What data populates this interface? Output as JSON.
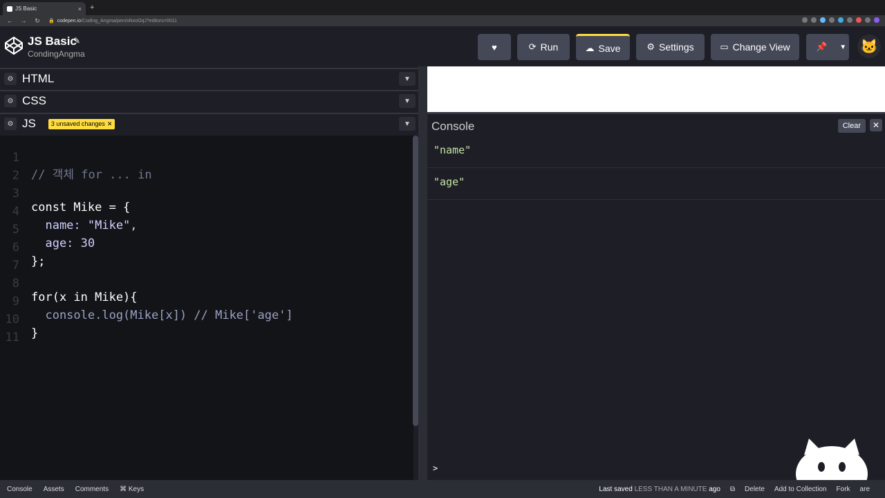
{
  "browser": {
    "tab_title": "JS Basic",
    "url_host": "codepen.io",
    "url_path": "/Coding_Angma/pen/oNxoOqJ?editors=0011",
    "new_tab": "+",
    "tab_close": "×"
  },
  "header": {
    "title": "JS Basic",
    "owner": "CondingAngma",
    "buttons": {
      "run": "Run",
      "save": "Save",
      "settings": "Settings",
      "change_view": "Change View"
    }
  },
  "panels": {
    "html": "HTML",
    "css": "CSS",
    "js": "JS",
    "unsaved": "3 unsaved changes"
  },
  "code_lines": [
    {
      "n": "1",
      "text": "// 객체 for ... in"
    },
    {
      "n": "2",
      "text": ""
    },
    {
      "n": "3",
      "text": "const Mike = {"
    },
    {
      "n": "4",
      "text": "  name: \"Mike\","
    },
    {
      "n": "5",
      "text": "  age: 30"
    },
    {
      "n": "6",
      "text": "};"
    },
    {
      "n": "7",
      "text": ""
    },
    {
      "n": "8",
      "text": "for(x in Mike){"
    },
    {
      "n": "9",
      "text": "  console.log(Mike[x]) // Mike['age']"
    },
    {
      "n": "10",
      "text": "}"
    },
    {
      "n": "11",
      "text": ""
    }
  ],
  "console": {
    "title": "Console",
    "clear": "Clear",
    "close": "✕",
    "logs": [
      "\"name\"",
      "\"age\""
    ],
    "prompt": ">"
  },
  "footer": {
    "left": [
      "Console",
      "Assets",
      "Comments",
      "⌘ Keys"
    ],
    "saved_label": "Last saved",
    "saved_time": "LESS THAN A MINUTE",
    "saved_suffix": "ago",
    "delete": "Delete",
    "add_to_collection": "Add to Collection",
    "fork": "Fork",
    "share": "are"
  },
  "colors": {
    "accent": "#ffdd40",
    "bg": "#131417",
    "panel": "#1e1f26"
  }
}
